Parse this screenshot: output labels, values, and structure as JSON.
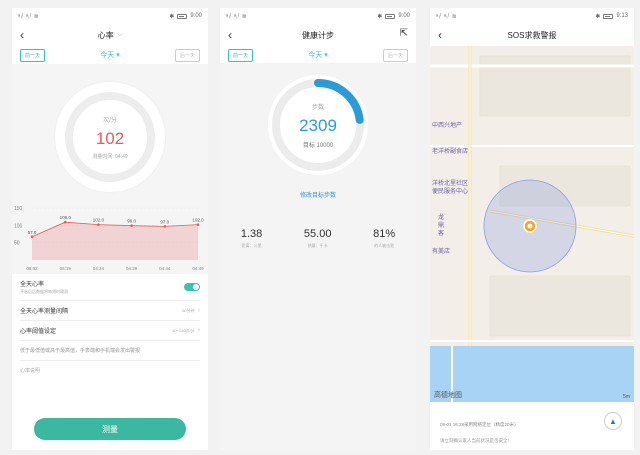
{
  "status": {
    "signal": "ᵃᵢˡ ᵃᵢˡ ≋",
    "screen1_time": "9:00",
    "screen2_time": "9:00",
    "screen3_time": "9:13"
  },
  "heart": {
    "title": "心率",
    "prev_day": "前一天",
    "day": "今天",
    "next_day": "后一天",
    "unit": "次/分",
    "value": "102",
    "measure_time": "测量时间: 04:49",
    "chart": {
      "y_ticks": [
        "150",
        "100",
        "50"
      ],
      "x_labels": [
        "08:02",
        "08:19",
        "04:24",
        "04:29",
        "04:44",
        "04:49"
      ],
      "values": [
        67.0,
        109.0,
        102.0,
        99.0,
        97.0,
        102.0
      ],
      "value_labels": [
        "67.0",
        "109.0",
        "102.0",
        "99.0",
        "97.0",
        "102.0"
      ],
      "ylim": [
        0,
        150
      ]
    },
    "settings": {
      "allday_label": "全天心率",
      "allday_sub": "开启后后数据将每隔时隔测",
      "interval_label": "全天心率测量间隔",
      "interval_value": "60分钟",
      "threshold_label": "心率阈值设定",
      "threshold_value": "40~140次/分",
      "hint": "低于最低值或高于最高值，手表端和手机端会发出警报",
      "note_label": "心率说明"
    },
    "measure_button": "测量"
  },
  "steps": {
    "title": "健康计步",
    "prev_day": "前一天",
    "day": "今天",
    "next_day": "后一天",
    "label": "步数",
    "value": "2309",
    "goal": "目标 10000",
    "progress": 0.23,
    "edit_goal": "修改目标步数",
    "stats": [
      {
        "value": "1.38",
        "label": "距离：公里"
      },
      {
        "value": "55.00",
        "label": "热量：千卡"
      },
      {
        "value": "81%",
        "label": "的人被击败"
      }
    ]
  },
  "sos": {
    "title": "SOS求救警报",
    "map_labels": [
      "中西兴地产",
      "老洋桥副食店",
      "洋桥北里社区",
      "便民服务中心",
      "龙鼎客",
      "有美店"
    ],
    "map_logo": "高德地图",
    "map_scale": "5m",
    "time_text": "09-01 16:28采用网络定位（精度20米）",
    "hint": "请立刻确认家人当前状况是否安全！"
  },
  "colors": {
    "teal": "#3ac4a9",
    "heart_red": "#e85a5a",
    "step_blue": "#2a9bd8"
  }
}
